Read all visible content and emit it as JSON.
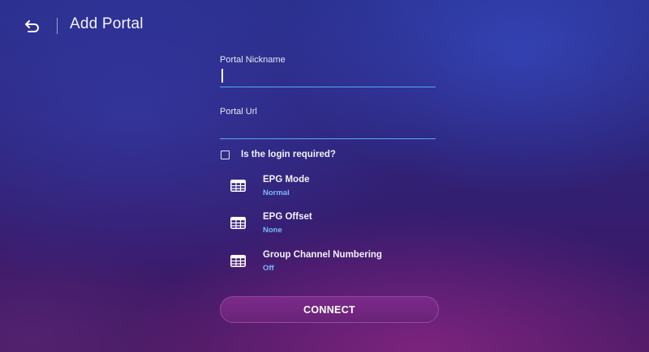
{
  "header": {
    "title": "Add Portal",
    "back_icon": "back-arrow-icon"
  },
  "form": {
    "nickname": {
      "label": "Portal Nickname",
      "value": "",
      "focused": true
    },
    "url": {
      "label": "Portal Url",
      "value": ""
    },
    "login_required": {
      "label": "Is the login required?",
      "checked": false
    }
  },
  "settings": [
    {
      "name": "EPG Mode",
      "value": "Normal",
      "icon": "grid-list-icon"
    },
    {
      "name": "EPG Offset",
      "value": "None",
      "icon": "grid-list-icon"
    },
    {
      "name": "Group Channel Numbering",
      "value": "Off",
      "icon": "grid-list-icon"
    }
  ],
  "actions": {
    "connect_label": "CONNECT"
  },
  "colors": {
    "accent": "#5aa6ff",
    "value_text": "#7ab8ff",
    "button_bg": "#74268a"
  }
}
